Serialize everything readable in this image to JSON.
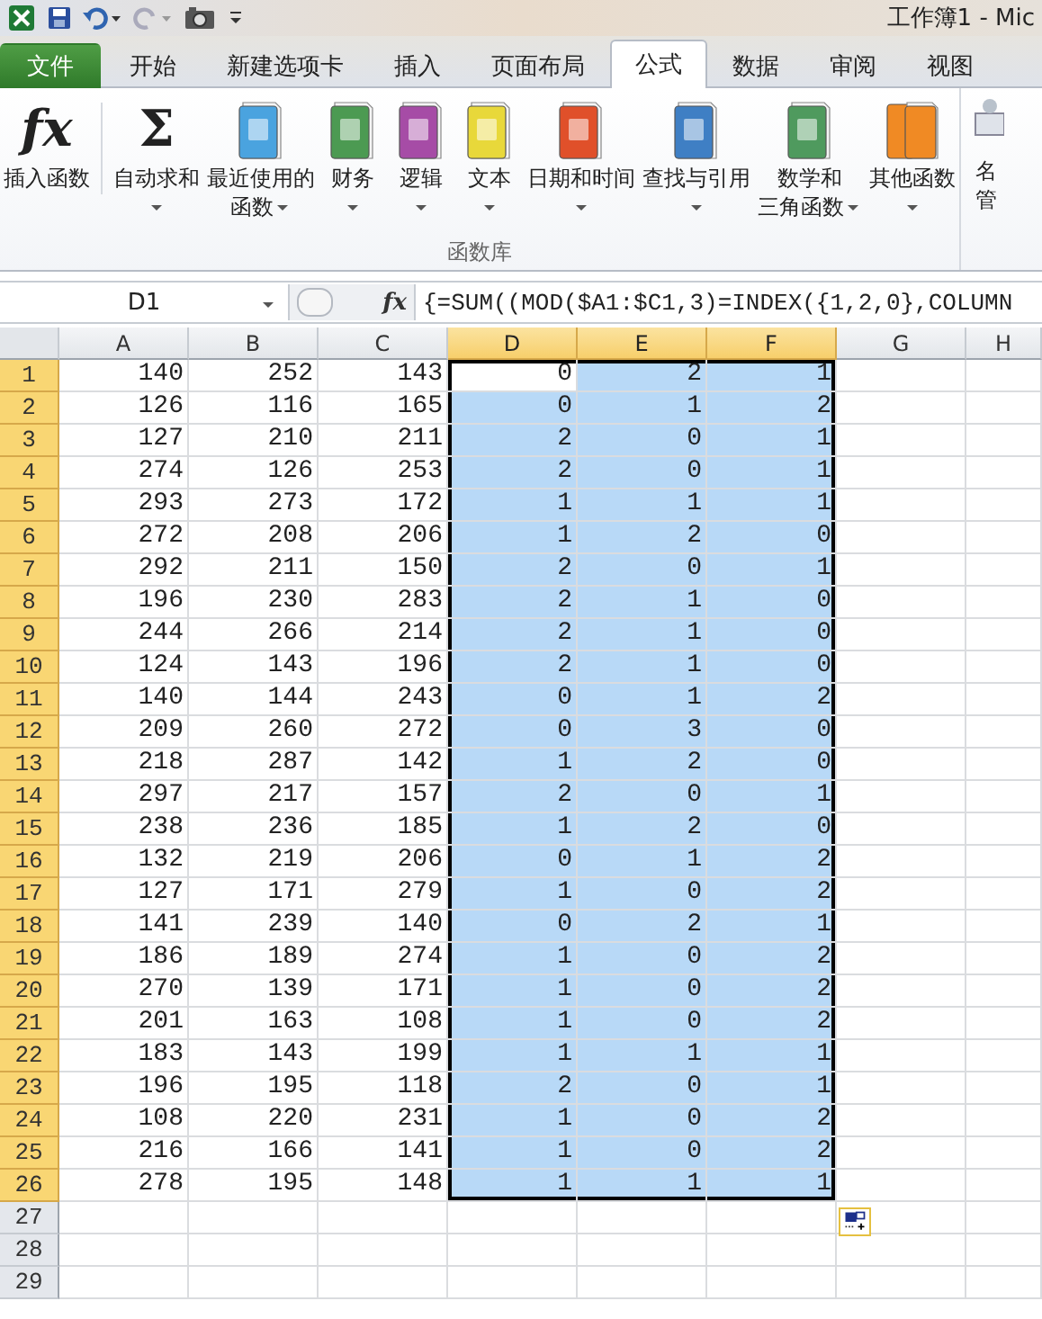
{
  "title_bar": {
    "title": "工作簿1  -  Mic"
  },
  "ribbon_tabs": [
    {
      "label": "文件",
      "kind": "file",
      "selected": false
    },
    {
      "label": "开始",
      "kind": "tab",
      "selected": false
    },
    {
      "label": "新建选项卡",
      "kind": "tab",
      "selected": false
    },
    {
      "label": "插入",
      "kind": "tab",
      "selected": false
    },
    {
      "label": "页面布局",
      "kind": "tab",
      "selected": false
    },
    {
      "label": "公式",
      "kind": "tab",
      "selected": true
    },
    {
      "label": "数据",
      "kind": "tab",
      "selected": false
    },
    {
      "label": "审阅",
      "kind": "tab",
      "selected": false
    },
    {
      "label": "视图",
      "kind": "tab",
      "selected": false
    }
  ],
  "ribbon": {
    "group_label": "函数库",
    "buttons": [
      {
        "kind": "glyph",
        "glyph": "fx",
        "lines": [
          "插入函数"
        ],
        "dropdown": false
      },
      {
        "kind": "glyph",
        "glyph": "Σ",
        "lines": [
          "自动求和"
        ],
        "dropdown": true
      },
      {
        "kind": "book",
        "color": "#4aa3df",
        "lines": [
          "最近使用的",
          "函数"
        ],
        "dropdown": true
      },
      {
        "kind": "book",
        "color": "#4c9a52",
        "lines": [
          "财务"
        ],
        "dropdown": true
      },
      {
        "kind": "book",
        "color": "#a64ca6",
        "lines": [
          "逻辑"
        ],
        "dropdown": true
      },
      {
        "kind": "book",
        "color": "#e8d83a",
        "lines": [
          "文本"
        ],
        "dropdown": true
      },
      {
        "kind": "book",
        "color": "#e0502a",
        "lines": [
          "日期和时间"
        ],
        "dropdown": true
      },
      {
        "kind": "book",
        "color": "#3f7fc4",
        "lines": [
          "查找与引用"
        ],
        "dropdown": true
      },
      {
        "kind": "book",
        "color": "#4f9a5e",
        "lines": [
          "数学和",
          "三角函数"
        ],
        "dropdown": true
      },
      {
        "kind": "books",
        "color": "#f08a24",
        "lines": [
          "其他函数"
        ],
        "dropdown": true
      }
    ],
    "cut_button": {
      "lines": [
        "名",
        "管"
      ]
    }
  },
  "formula_bar": {
    "name_box": "D1",
    "fx": "fx",
    "formula": "{=SUM((MOD($A1:$C1,3)=INDEX({1,2,0},COLUMN"
  },
  "grid": {
    "columns": [
      {
        "label": "A",
        "selected": false
      },
      {
        "label": "B",
        "selected": false
      },
      {
        "label": "C",
        "selected": false
      },
      {
        "label": "D",
        "selected": true
      },
      {
        "label": "E",
        "selected": true
      },
      {
        "label": "F",
        "selected": true
      },
      {
        "label": "G",
        "selected": false
      },
      {
        "label": "H",
        "selected": false
      }
    ],
    "rows": [
      {
        "header": "1",
        "selected": true,
        "active": true,
        "cells": [
          "140",
          "252",
          "143",
          "0",
          "2",
          "1"
        ]
      },
      {
        "header": "2",
        "selected": true,
        "active": false,
        "cells": [
          "126",
          "116",
          "165",
          "0",
          "1",
          "2"
        ]
      },
      {
        "header": "3",
        "selected": true,
        "active": false,
        "cells": [
          "127",
          "210",
          "211",
          "2",
          "0",
          "1"
        ]
      },
      {
        "header": "4",
        "selected": true,
        "active": false,
        "cells": [
          "274",
          "126",
          "253",
          "2",
          "0",
          "1"
        ]
      },
      {
        "header": "5",
        "selected": true,
        "active": false,
        "cells": [
          "293",
          "273",
          "172",
          "1",
          "1",
          "1"
        ]
      },
      {
        "header": "6",
        "selected": true,
        "active": false,
        "cells": [
          "272",
          "208",
          "206",
          "1",
          "2",
          "0"
        ]
      },
      {
        "header": "7",
        "selected": true,
        "active": false,
        "cells": [
          "292",
          "211",
          "150",
          "2",
          "0",
          "1"
        ]
      },
      {
        "header": "8",
        "selected": true,
        "active": false,
        "cells": [
          "196",
          "230",
          "283",
          "2",
          "1",
          "0"
        ]
      },
      {
        "header": "9",
        "selected": true,
        "active": false,
        "cells": [
          "244",
          "266",
          "214",
          "2",
          "1",
          "0"
        ]
      },
      {
        "header": "10",
        "selected": true,
        "active": false,
        "cells": [
          "124",
          "143",
          "196",
          "2",
          "1",
          "0"
        ]
      },
      {
        "header": "11",
        "selected": true,
        "active": false,
        "cells": [
          "140",
          "144",
          "243",
          "0",
          "1",
          "2"
        ]
      },
      {
        "header": "12",
        "selected": true,
        "active": false,
        "cells": [
          "209",
          "260",
          "272",
          "0",
          "3",
          "0"
        ]
      },
      {
        "header": "13",
        "selected": true,
        "active": false,
        "cells": [
          "218",
          "287",
          "142",
          "1",
          "2",
          "0"
        ]
      },
      {
        "header": "14",
        "selected": true,
        "active": false,
        "cells": [
          "297",
          "217",
          "157",
          "2",
          "0",
          "1"
        ]
      },
      {
        "header": "15",
        "selected": true,
        "active": false,
        "cells": [
          "238",
          "236",
          "185",
          "1",
          "2",
          "0"
        ]
      },
      {
        "header": "16",
        "selected": true,
        "active": false,
        "cells": [
          "132",
          "219",
          "206",
          "0",
          "1",
          "2"
        ]
      },
      {
        "header": "17",
        "selected": true,
        "active": false,
        "cells": [
          "127",
          "171",
          "279",
          "1",
          "0",
          "2"
        ]
      },
      {
        "header": "18",
        "selected": true,
        "active": false,
        "cells": [
          "141",
          "239",
          "140",
          "0",
          "2",
          "1"
        ]
      },
      {
        "header": "19",
        "selected": true,
        "active": false,
        "cells": [
          "186",
          "189",
          "274",
          "1",
          "0",
          "2"
        ]
      },
      {
        "header": "20",
        "selected": true,
        "active": false,
        "cells": [
          "270",
          "139",
          "171",
          "1",
          "0",
          "2"
        ]
      },
      {
        "header": "21",
        "selected": true,
        "active": false,
        "cells": [
          "201",
          "163",
          "108",
          "1",
          "0",
          "2"
        ]
      },
      {
        "header": "22",
        "selected": true,
        "active": false,
        "cells": [
          "183",
          "143",
          "199",
          "1",
          "1",
          "1"
        ]
      },
      {
        "header": "23",
        "selected": true,
        "active": false,
        "cells": [
          "196",
          "195",
          "118",
          "2",
          "0",
          "1"
        ]
      },
      {
        "header": "24",
        "selected": true,
        "active": false,
        "cells": [
          "108",
          "220",
          "231",
          "1",
          "0",
          "2"
        ]
      },
      {
        "header": "25",
        "selected": true,
        "active": false,
        "cells": [
          "216",
          "166",
          "141",
          "1",
          "0",
          "2"
        ]
      },
      {
        "header": "26",
        "selected": true,
        "active": false,
        "cells": [
          "278",
          "195",
          "148",
          "1",
          "1",
          "1"
        ]
      },
      {
        "header": "27",
        "selected": false,
        "active": false,
        "cells": []
      },
      {
        "header": "28",
        "selected": false,
        "active": false,
        "cells": []
      },
      {
        "header": "29",
        "selected": false,
        "active": false,
        "cells": []
      }
    ]
  }
}
